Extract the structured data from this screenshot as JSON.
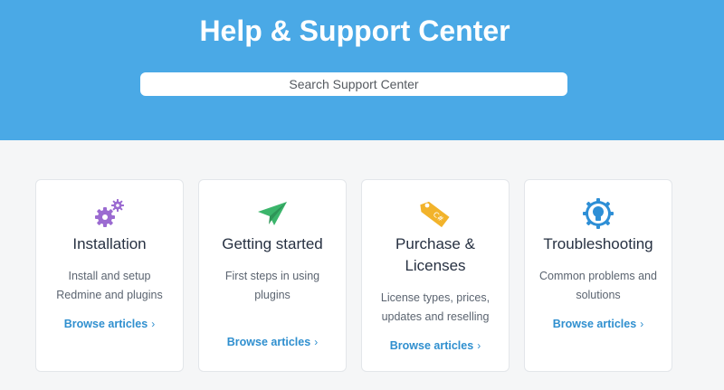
{
  "hero": {
    "title": "Help & Support Center",
    "search_placeholder": "Search Support Center"
  },
  "colors": {
    "hero_bg": "#4aa9e6",
    "link": "#2f8fcf",
    "installation_icon": "#9b6bd1",
    "getting_started_icon": "#3bb56b",
    "purchase_icon": "#f2b32b",
    "troubleshooting_icon": "#2e8fd6"
  },
  "cards": [
    {
      "icon": "gears-icon",
      "title": "Installation",
      "description": "Install and setup Redmine and plugins",
      "link": "Browse articles",
      "link_chevron": "›"
    },
    {
      "icon": "paper-plane-icon",
      "title": "Getting started",
      "description": "First steps in using plugins",
      "link": "Browse articles",
      "link_chevron": "›"
    },
    {
      "icon": "price-tag-icon",
      "title": "Purchase & Licenses",
      "description": "License types, prices, updates and reselling",
      "link": "Browse articles",
      "link_chevron": "›"
    },
    {
      "icon": "lightbulb-gear-icon",
      "title": "Troubleshooting",
      "description": "Common problems and solutions",
      "link": "Browse articles",
      "link_chevron": "›"
    }
  ]
}
